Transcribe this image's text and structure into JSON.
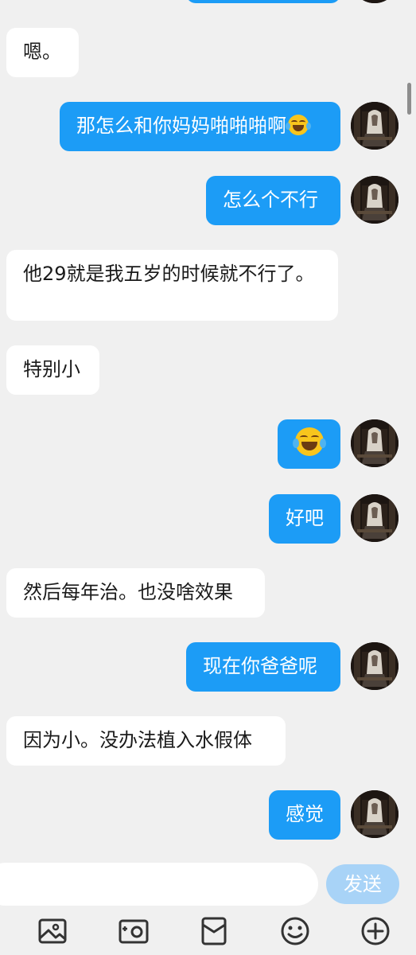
{
  "messages": [
    {
      "side": "out",
      "text": ""
    },
    {
      "side": "in",
      "text": "嗯。"
    },
    {
      "side": "out",
      "text": "那怎么和你妈妈啪啪啪啊",
      "emoji": "tears-of-joy-emoji"
    },
    {
      "side": "out",
      "text": "怎么个不行"
    },
    {
      "side": "in",
      "text": "他29就是我五岁的时候就不行了。"
    },
    {
      "side": "in",
      "text": "特别小"
    },
    {
      "side": "out",
      "text": "",
      "emoji": "tears-of-joy-emoji"
    },
    {
      "side": "out",
      "text": "好吧"
    },
    {
      "side": "in",
      "text": "然后每年治。也没啥效果"
    },
    {
      "side": "out",
      "text": "现在你爸爸呢"
    },
    {
      "side": "in",
      "text": "因为小。没办法植入水假体"
    },
    {
      "side": "out",
      "text": "感觉"
    }
  ],
  "input": {
    "value": "",
    "placeholder": ""
  },
  "send_label": "发送",
  "toolbar": {
    "icons": [
      "image-icon",
      "camera-icon",
      "red-packet-icon",
      "smiley-icon",
      "plus-icon"
    ]
  },
  "colors": {
    "outgoing_bubble": "#1c9cf6",
    "incoming_bubble": "#ffffff",
    "background": "#f0f0f0",
    "send_button": "#a8d3f7"
  }
}
